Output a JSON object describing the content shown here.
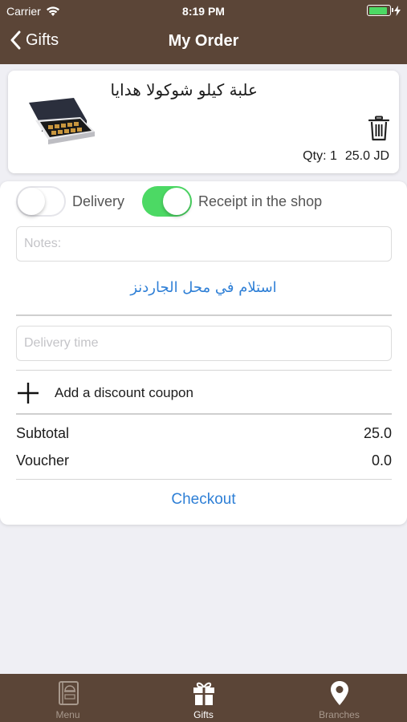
{
  "status_bar": {
    "carrier": "Carrier",
    "time": "8:19 PM",
    "battery_level": 0.9
  },
  "nav": {
    "back_label": "Gifts",
    "title": "My Order"
  },
  "product": {
    "name": "علبة كيلو شوكولا هدايا",
    "qty_label": "Qty: 1",
    "price": "25.0 JD"
  },
  "delivery": {
    "delivery_label": "Delivery",
    "delivery_on": false,
    "pickup_label": "Receipt in the shop",
    "pickup_on": true
  },
  "notes": {
    "placeholder": "Notes:",
    "value": ""
  },
  "branch": {
    "label": "استلام في محل الجاردنز"
  },
  "delivery_time": {
    "placeholder": "Delivery time",
    "value": ""
  },
  "coupon": {
    "label": "Add a discount coupon"
  },
  "summary": {
    "subtotal_label": "Subtotal",
    "subtotal_value": "25.0",
    "voucher_label": "Voucher",
    "voucher_value": "0.0"
  },
  "checkout": {
    "label": "Checkout"
  },
  "tabs": [
    {
      "label": "Menu",
      "icon": "menu-book-icon",
      "active": false
    },
    {
      "label": "Gifts",
      "icon": "gift-icon",
      "active": true
    },
    {
      "label": "Branches",
      "icon": "location-pin-icon",
      "active": false
    }
  ],
  "colors": {
    "brand": "#5b4537",
    "accent": "#2e7fd6",
    "toggle_on": "#4cd964"
  }
}
